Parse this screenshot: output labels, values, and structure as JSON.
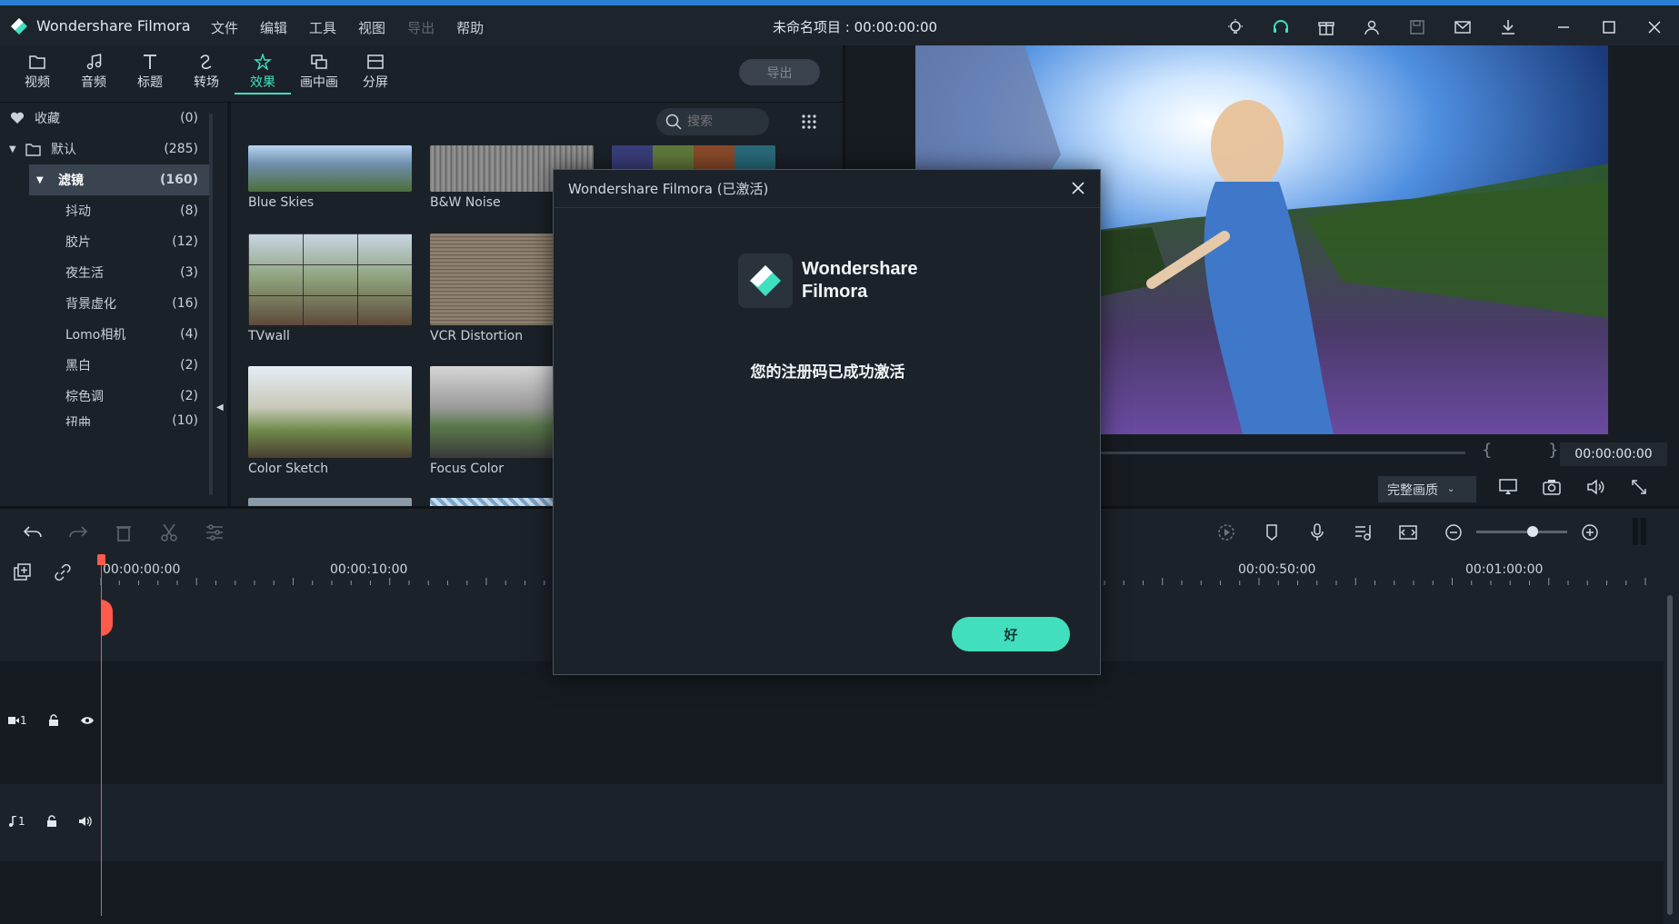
{
  "app": {
    "name": "Wondershare Filmora"
  },
  "menu": [
    "文件",
    "编辑",
    "工具",
    "视图",
    "导出",
    "帮助"
  ],
  "project_title": "未命名项目 : 00:00:00:00",
  "tabs": [
    {
      "label": "视频",
      "icon": "folder-icon"
    },
    {
      "label": "音频",
      "icon": "music-note-icon"
    },
    {
      "label": "标题",
      "icon": "text-icon"
    },
    {
      "label": "转场",
      "icon": "transition-icon"
    },
    {
      "label": "效果",
      "icon": "effects-icon"
    },
    {
      "label": "画中画",
      "icon": "pip-icon"
    },
    {
      "label": "分屏",
      "icon": "split-screen-icon"
    }
  ],
  "export_label": "导出",
  "sidebar": {
    "items": [
      {
        "label": "收藏",
        "count": "(0)"
      },
      {
        "label": "默认",
        "count": "(285)"
      },
      {
        "label": "滤镜",
        "count": "(160)"
      },
      {
        "label": "抖动",
        "count": "(8)"
      },
      {
        "label": "胶片",
        "count": "(12)"
      },
      {
        "label": "夜生活",
        "count": "(3)"
      },
      {
        "label": "背景虚化",
        "count": "(16)"
      },
      {
        "label": "Lomo相机",
        "count": "(4)"
      },
      {
        "label": "黑白",
        "count": "(2)"
      },
      {
        "label": "棕色调",
        "count": "(2)"
      },
      {
        "label": "扭曲",
        "count": "(10)"
      }
    ]
  },
  "search": {
    "placeholder": "搜索"
  },
  "effects": [
    {
      "label": "Blue Skies"
    },
    {
      "label": "B&W Noise"
    },
    {
      "label": "TVwall"
    },
    {
      "label": "VCR Distortion"
    },
    {
      "label": "Color Sketch"
    },
    {
      "label": "Focus Color"
    }
  ],
  "preview": {
    "time": "00:00:00:00",
    "quality": "完整画质"
  },
  "timeline": {
    "ruler": [
      "00:00:00:00",
      "00:00:10:00",
      "00:00:50:00",
      "00:01:00:00"
    ],
    "video_track": "1",
    "audio_track": "1"
  },
  "dialog": {
    "title": "Wondershare Filmora (已激活)",
    "brand_line1": "Wondershare",
    "brand_line2": "Filmora",
    "message": "您的注册码已成功激活",
    "ok_label": "好"
  },
  "colors": {
    "accent": "#41dfbd",
    "playhead": "#ff5a4a",
    "titlebar_top": "#2a7fd4"
  }
}
